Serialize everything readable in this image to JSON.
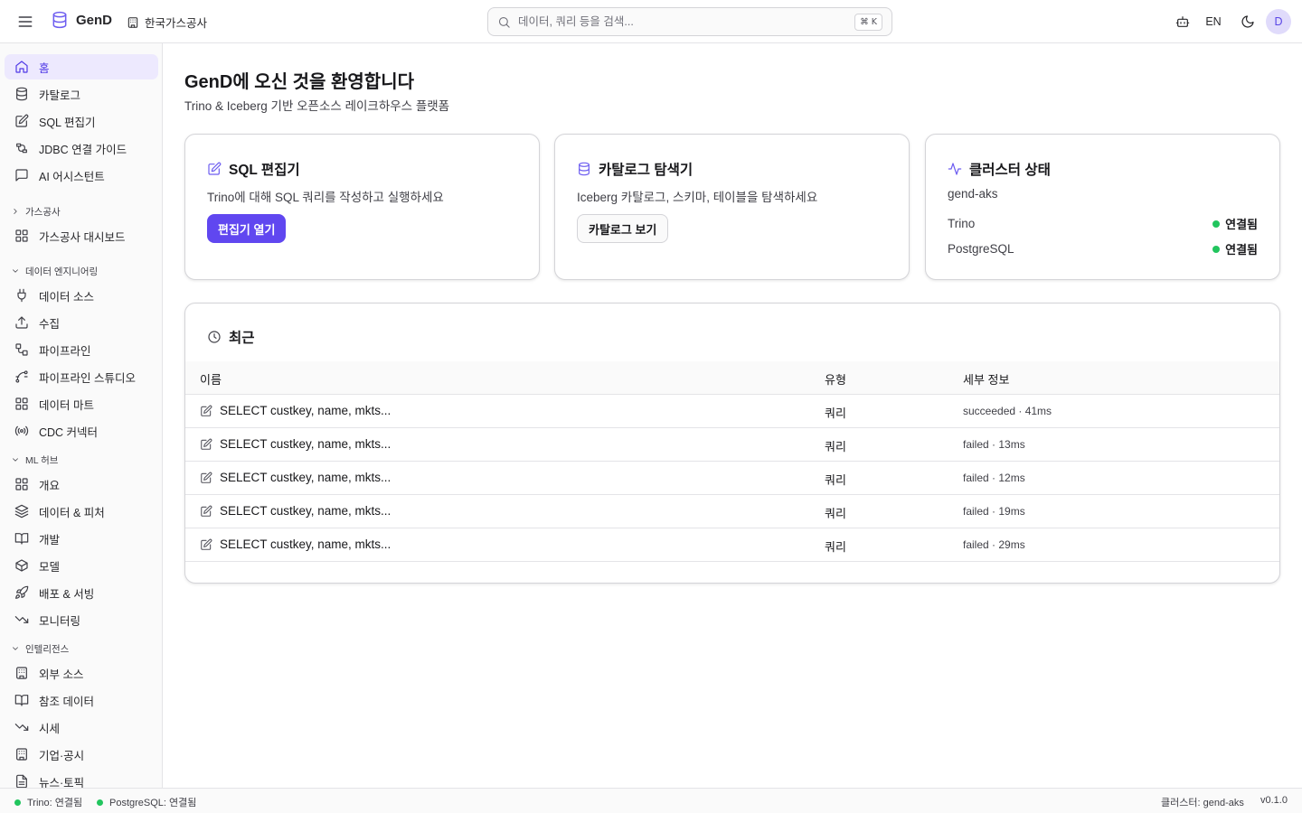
{
  "header": {
    "brand": "GenD",
    "org": "한국가스공사",
    "search_placeholder": "데이터, 쿼리 등을 검색...",
    "shortcut": "⌘ K",
    "lang": "EN",
    "avatar": "D"
  },
  "sidebar": {
    "home": "홈",
    "catalog": "카탈로그",
    "sql_editor": "SQL 편집기",
    "jdbc": "JDBC 연결 가이드",
    "ai": "AI 어시스턴트",
    "sec_gas": "가스공사",
    "gas_dashboard": "가스공사 대시보드",
    "sec_de": "데이터 엔지니어링",
    "data_source": "데이터 소스",
    "ingest": "수집",
    "pipeline": "파이프라인",
    "pipeline_studio": "파이프라인 스튜디오",
    "data_mart": "데이터 마트",
    "cdc": "CDC 커넥터",
    "sec_ml": "ML 허브",
    "overview": "개요",
    "data_feature": "데이터 & 피처",
    "dev": "개발",
    "model": "모델",
    "deploy": "배포 & 서빙",
    "monitoring": "모니터링",
    "sec_intel": "인텔리전스",
    "external": "외부 소스",
    "reference": "참조 데이터",
    "price": "시세",
    "company": "기업·공시",
    "news": "뉴스·토픽"
  },
  "main": {
    "title": "GenD에 오신 것을 환영합니다",
    "subtitle": "Trino & Iceberg 기반 오픈소스 레이크하우스 플랫폼",
    "card_sql": {
      "title": "SQL 편집기",
      "desc": "Trino에 대해 SQL 쿼리를 작성하고 실행하세요",
      "button": "편집기 열기"
    },
    "card_catalog": {
      "title": "카탈로그 탐색기",
      "desc": "Iceberg 카탈로그, 스키마, 테이블을 탐색하세요",
      "button": "카탈로그 보기"
    },
    "card_cluster": {
      "title": "클러스터 상태",
      "name": "gend-aks",
      "rows": [
        {
          "label": "Trino",
          "status": "연결됨"
        },
        {
          "label": "PostgreSQL",
          "status": "연결됨"
        }
      ]
    },
    "recent": {
      "title": "최근",
      "columns": [
        "이름",
        "유형",
        "세부 정보"
      ],
      "rows": [
        {
          "name": "SELECT custkey, name, mkts...",
          "type": "쿼리",
          "detail": "succeeded · 41ms"
        },
        {
          "name": "SELECT custkey, name, mkts...",
          "type": "쿼리",
          "detail": "failed · 13ms"
        },
        {
          "name": "SELECT custkey, name, mkts...",
          "type": "쿼리",
          "detail": "failed · 12ms"
        },
        {
          "name": "SELECT custkey, name, mkts...",
          "type": "쿼리",
          "detail": "failed · 19ms"
        },
        {
          "name": "SELECT custkey, name, mkts...",
          "type": "쿼리",
          "detail": "failed · 29ms"
        }
      ]
    }
  },
  "footer": {
    "trino": "Trino: 연결됨",
    "postgres": "PostgreSQL: 연결됨",
    "cluster": "클러스터: gend-aks",
    "version": "v0.1.0"
  },
  "colors": {
    "accent": "#6047f0",
    "status_ok": "#22c55e"
  }
}
